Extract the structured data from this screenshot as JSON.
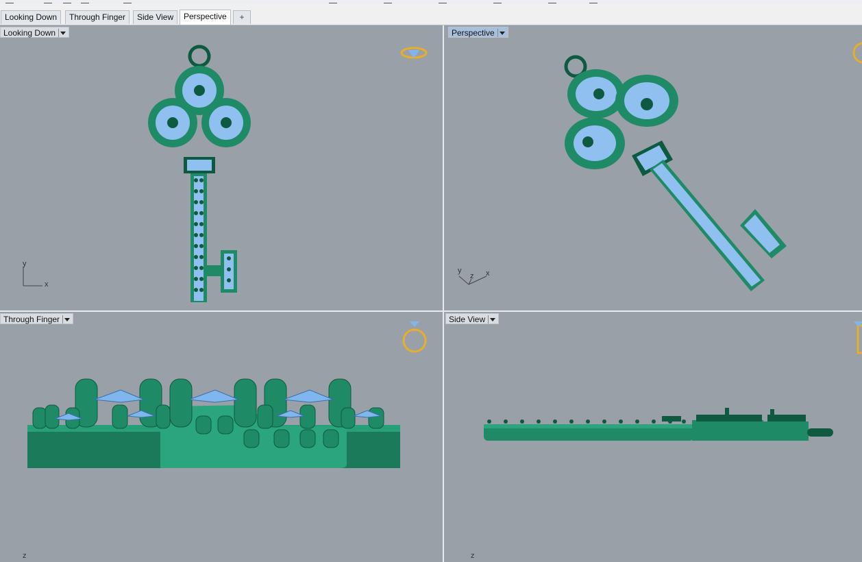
{
  "tabs": [
    {
      "label": "Looking Down",
      "active": false
    },
    {
      "label": "Through Finger",
      "active": false
    },
    {
      "label": "Side View",
      "active": false
    },
    {
      "label": "Perspective",
      "active": true
    }
  ],
  "tab_add_label": "+",
  "viewports": {
    "top_left": {
      "label": "Looking Down",
      "axis_y": "y",
      "axis_x": "x"
    },
    "top_right": {
      "label": "Perspective",
      "axis_y": "y",
      "axis_z": "z",
      "axis_x": "x"
    },
    "bottom_left": {
      "label": "Through Finger",
      "axis_z": "z"
    },
    "bottom_right": {
      "label": "Side View",
      "axis_z": "z"
    }
  },
  "colors": {
    "viewport_bg": "#9aa0a7",
    "metal": "#1f8a66",
    "metal_dark": "#0e5a41",
    "gem": "#7fb6ee",
    "ring_icon": "#e6ae2b"
  },
  "icons": [
    "ring-top-icon",
    "ring-front-icon",
    "ring-side-icon",
    "dropdown-arrow-icon",
    "add-tab-icon"
  ]
}
